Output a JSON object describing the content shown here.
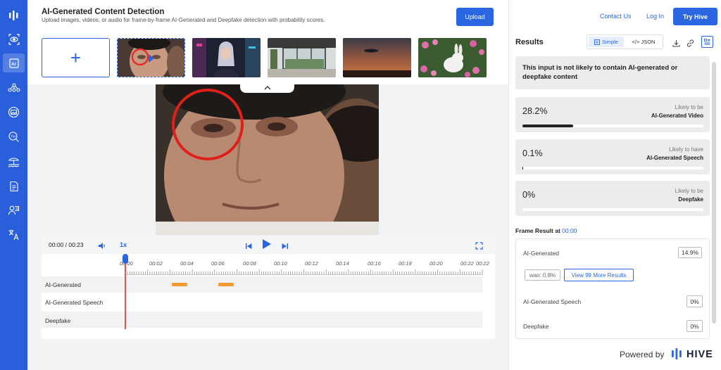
{
  "header": {
    "title": "AI-Generated Content Detection",
    "subtitle": "Upload images, videos, or audio for frame-by-frame AI-Generated and Deepfake detection with probability scores.",
    "upload_label": "Upload"
  },
  "nav": {
    "contact": "Contact Us",
    "login": "Log In",
    "try": "Try Hive"
  },
  "sidebar": {
    "items": [
      "logo-icon",
      "eye-scan-icon",
      "ai-detect-icon",
      "network-icon",
      "image-scan-icon",
      "trademark-icon",
      "beach-icon",
      "document-icon",
      "speech-icon",
      "translate-icon"
    ]
  },
  "thumbnails": {
    "add_label": "+",
    "items": [
      "face-video-thumbnail",
      "cyber-woman-thumbnail",
      "interior-thumbnail",
      "sunset-ufo-thumbnail",
      "bunny-flowers-thumbnail"
    ]
  },
  "player": {
    "time": "00:00 / 00:23",
    "speed": "1x",
    "ticks": [
      "00:00",
      "00:02",
      "00:04",
      "00:06",
      "00:08",
      "00:10",
      "00:12",
      "00:14",
      "00:16",
      "00:18",
      "00:20",
      "00:22",
      "00:22"
    ],
    "tracks": [
      {
        "label": "AI-Generated"
      },
      {
        "label": "AI-Generated Speech"
      },
      {
        "label": "Deepfake"
      }
    ]
  },
  "results": {
    "title": "Results",
    "toggle_simple": "Simple",
    "toggle_json": "</> JSON",
    "summary": "This input is not likely to contain AI-generated or deepfake content",
    "cards": [
      {
        "score": "28.2%",
        "line1": "Likely to be",
        "line2": "AI-Generated Video",
        "fraction": 0.282
      },
      {
        "score": "0.1%",
        "line1": "Likely to have",
        "line2": "AI-Generated Speech",
        "fraction": 0.001
      },
      {
        "score": "0%",
        "line1": "Likely to be",
        "line2": "Deepfake",
        "fraction": 0
      }
    ],
    "frame_title": "Frame Result at ",
    "frame_time": "00:00",
    "frame": {
      "ai_label": "AI-Generated",
      "ai_value": "14.9%",
      "wan": "wan: 0.8%",
      "more": "View 99 More Results",
      "speech_label": "AI-Generated Speech",
      "speech_value": "0%",
      "deepfake_label": "Deepfake",
      "deepfake_value": "0%"
    }
  },
  "footer": {
    "powered": "Powered by",
    "brand": "HIVE"
  },
  "colors": {
    "accent": "#2a66e0",
    "sidebar": "#2a5fdc",
    "segment": "#f59b2f"
  }
}
